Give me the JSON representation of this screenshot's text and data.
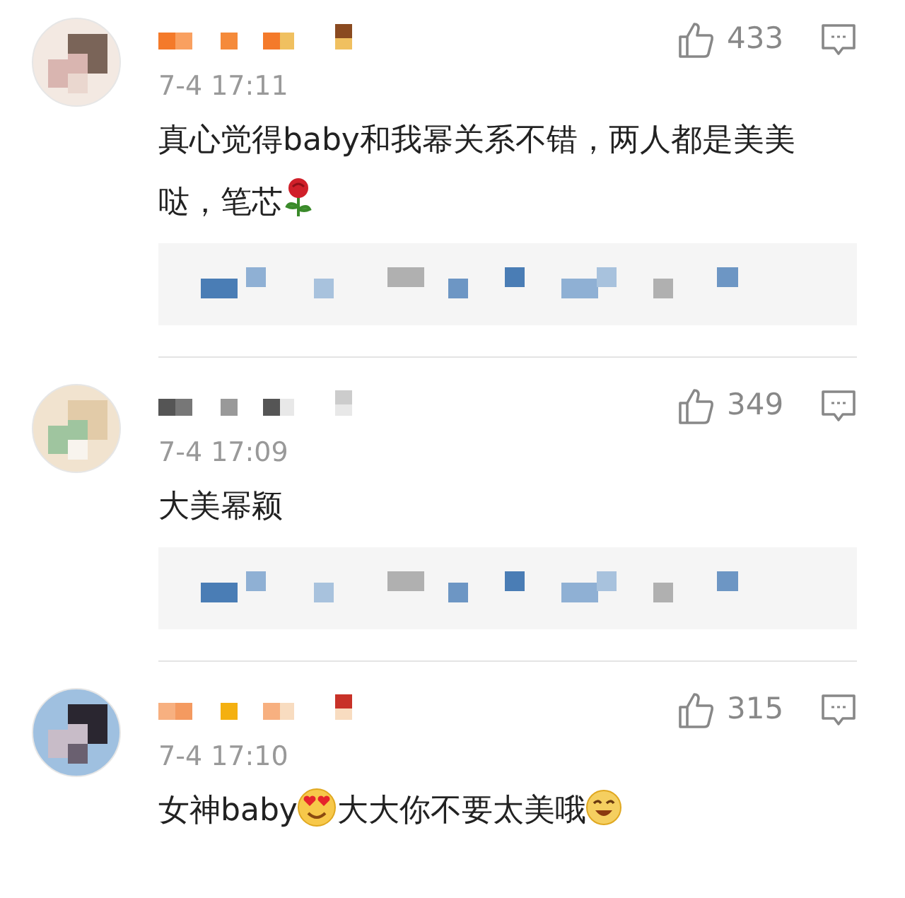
{
  "comments": [
    {
      "likes": "433",
      "time": "7-4 17:11",
      "body": [
        {
          "kind": "text",
          "text": "真心觉得baby和我幂关系不错，两人都是美美哒，笔芯"
        },
        {
          "kind": "rose"
        }
      ],
      "has_replies": true
    },
    {
      "likes": "349",
      "time": "7-4 17:09",
      "body": [
        {
          "kind": "text",
          "text": "大美幂颖"
        }
      ],
      "has_replies": true
    },
    {
      "likes": "315",
      "time": "7-4 17:10",
      "body": [
        {
          "kind": "text",
          "text": "女神baby"
        },
        {
          "kind": "heart-eyes"
        },
        {
          "kind": "text",
          "text": "大大你不要太美哦"
        },
        {
          "kind": "laughing"
        }
      ],
      "has_replies": false
    }
  ]
}
